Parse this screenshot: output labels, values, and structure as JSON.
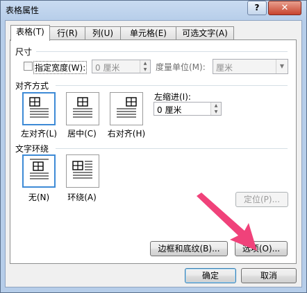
{
  "window": {
    "title": "表格属性",
    "help_label": "?",
    "close_label": "✕"
  },
  "tabs": [
    {
      "label": "表格(T)",
      "active": true
    },
    {
      "label": "行(R)",
      "active": false
    },
    {
      "label": "列(U)",
      "active": false
    },
    {
      "label": "单元格(E)",
      "active": false
    },
    {
      "label": "可选文字(A)",
      "active": false
    }
  ],
  "size": {
    "group_label": "尺寸",
    "preferred_width_label": "指定宽度(W):",
    "preferred_width_checked": false,
    "width_value": "0 厘米",
    "measure_label": "度量单位(M):",
    "measure_value": "厘米"
  },
  "alignment": {
    "group_label": "对齐方式",
    "options": [
      "左对齐(L)",
      "居中(C)",
      "右对齐(H)"
    ],
    "selected": "左对齐(L)",
    "indent_label": "左缩进(I):",
    "indent_value": "0 厘米"
  },
  "wrapping": {
    "group_label": "文字环绕",
    "options": [
      "无(N)",
      "环绕(A)"
    ],
    "selected": "无(N)",
    "positioning_label": "定位(P)..."
  },
  "buttons": {
    "borders_label": "边框和底纹(B)...",
    "options_label": "选项(O)...",
    "ok_label": "确定",
    "cancel_label": "取消"
  },
  "accent_colors": {
    "selection_border": "#3d8ad6",
    "annotation_arrow": "#f0427a"
  }
}
